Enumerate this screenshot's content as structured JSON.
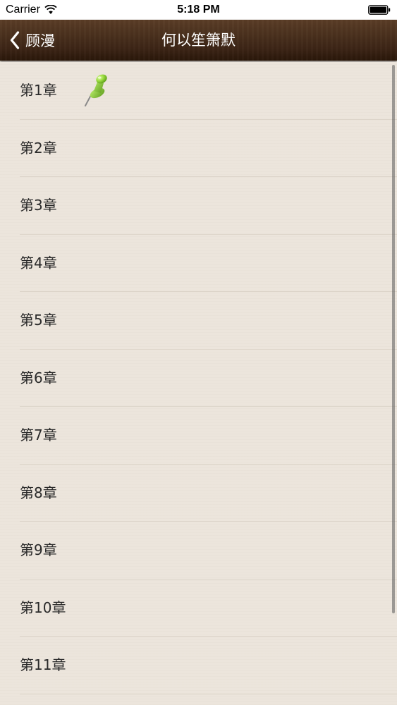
{
  "status_bar": {
    "carrier": "Carrier",
    "time": "5:18 PM"
  },
  "nav": {
    "back_label": "顾漫",
    "title": "何以笙箫默"
  },
  "chapters": [
    {
      "label": "第1章",
      "bookmarked": true
    },
    {
      "label": "第2章",
      "bookmarked": false
    },
    {
      "label": "第3章",
      "bookmarked": false
    },
    {
      "label": "第4章",
      "bookmarked": false
    },
    {
      "label": "第5章",
      "bookmarked": false
    },
    {
      "label": "第6章",
      "bookmarked": false
    },
    {
      "label": "第7章",
      "bookmarked": false
    },
    {
      "label": "第8章",
      "bookmarked": false
    },
    {
      "label": "第9章",
      "bookmarked": false
    },
    {
      "label": "第10章",
      "bookmarked": false
    },
    {
      "label": "第11章",
      "bookmarked": false
    }
  ],
  "colors": {
    "nav_background": "#3b2415",
    "list_background": "#ece5dc",
    "pin_green": "#8cd43a"
  }
}
